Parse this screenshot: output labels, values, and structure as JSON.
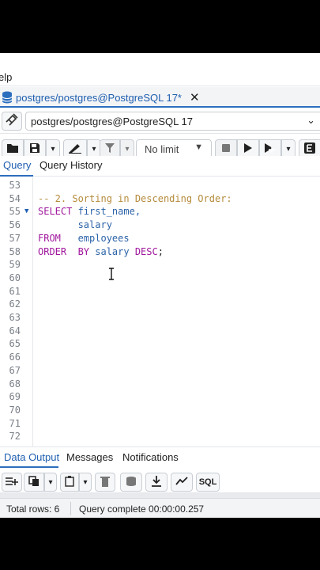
{
  "menubar": {
    "help_label": "elp"
  },
  "query_tab": {
    "title": "postgres/postgres@PostgreSQL 17*"
  },
  "connection": {
    "selected": "postgres/postgres@PostgreSQL 17"
  },
  "toolbar": {
    "limit_value": "No limit"
  },
  "editor_tabs": {
    "query": "Query",
    "history": "Query History"
  },
  "editor": {
    "line_numbers": [
      "53",
      "54",
      "55",
      "56",
      "57",
      "58",
      "59",
      "60",
      "61",
      "62",
      "63",
      "64",
      "65",
      "66",
      "67",
      "68",
      "69",
      "70",
      "71",
      "72"
    ],
    "lines": [
      {
        "segments": []
      },
      {
        "segments": [
          {
            "text": "-- 2. Sorting in Descending Order:",
            "cls": "c-comment"
          }
        ]
      },
      {
        "fold": true,
        "segments": [
          {
            "text": "SELECT",
            "cls": "c-kw"
          },
          {
            "text": " first_name,",
            "cls": "c-id"
          }
        ]
      },
      {
        "segments": [
          {
            "text": "       salary",
            "cls": "c-id"
          }
        ]
      },
      {
        "segments": [
          {
            "text": "FROM",
            "cls": "c-kw"
          },
          {
            "text": "   employees",
            "cls": "c-id"
          }
        ]
      },
      {
        "segments": [
          {
            "text": "ORDER  BY",
            "cls": "c-kw"
          },
          {
            "text": " salary ",
            "cls": "c-id"
          },
          {
            "text": "DESC",
            "cls": "c-kw"
          },
          {
            "text": ";",
            "cls": ""
          }
        ]
      },
      {
        "segments": []
      },
      {
        "segments": []
      },
      {
        "segments": []
      },
      {
        "segments": []
      },
      {
        "segments": []
      },
      {
        "segments": []
      },
      {
        "segments": []
      },
      {
        "segments": []
      },
      {
        "segments": []
      },
      {
        "segments": []
      },
      {
        "segments": []
      },
      {
        "segments": []
      },
      {
        "segments": []
      },
      {
        "segments": []
      }
    ]
  },
  "output_tabs": {
    "data_output": "Data Output",
    "messages": "Messages",
    "notifications": "Notifications"
  },
  "output_toolbar": {
    "sql_label": "SQL"
  },
  "status": {
    "rows": "Total rows: 6",
    "message": "Query complete 00:00:00.257"
  },
  "colors": {
    "accent": "#2c6ebe",
    "keyword": "#a0169d",
    "identifier": "#2c63a8",
    "comment": "#b58b3b"
  }
}
